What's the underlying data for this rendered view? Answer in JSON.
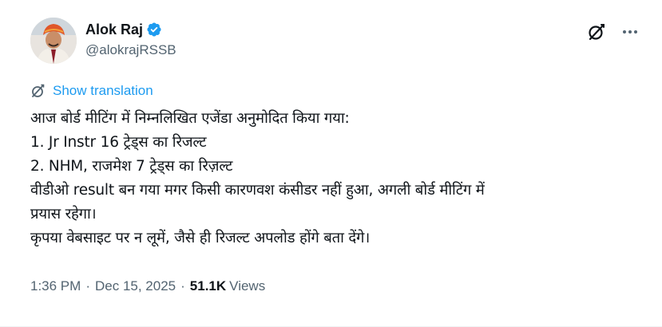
{
  "author": {
    "display_name": "Alok Raj",
    "handle": "@alokrajRSSB",
    "verified": true
  },
  "actions": {
    "grok_icon": "grok-icon",
    "more_icon": "more-horizontal-icon"
  },
  "translation": {
    "label": "Show translation",
    "icon": "globe-icon"
  },
  "post": {
    "lines": [
      "आज बोर्ड मीटिंग में निम्नलिखित एजेंडा अनुमोदित किया गया:",
      "1. Jr Instr 16 ट्रेड्स का रिजल्ट",
      "2. NHM, राजमेश 7 ट्रेड्स का रिज़ल्ट",
      "वीडीओ result बन गया मगर किसी कारणवश कंसीडर नहीं हुआ, अगली बोर्ड मीटिंग में",
      "प्रयास रहेगा।",
      "कृपया वेबसाइट पर न लूमें, जैसे ही रिजल्ट अपलोड होंगे बता देंगे।"
    ]
  },
  "meta": {
    "time": "1:36 PM",
    "separator": "·",
    "date": "Dec 15, 2025",
    "views_count": "51.1K",
    "views_label": "Views"
  },
  "colors": {
    "accent": "#1d9bf0",
    "secondary_text": "#536471",
    "primary_text": "#0f1419"
  }
}
